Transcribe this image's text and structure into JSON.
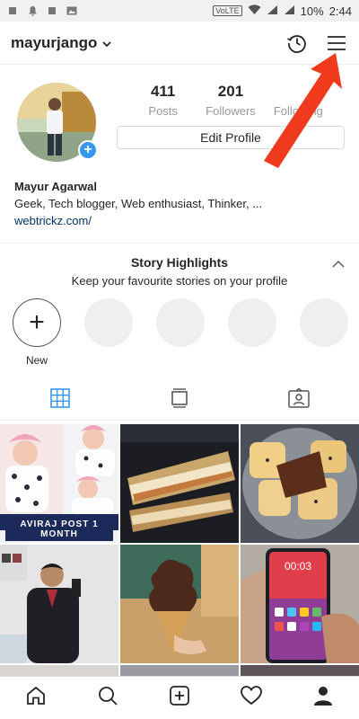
{
  "statusbar": {
    "network": "VoLTE",
    "battery": "10%",
    "time": "2:44"
  },
  "topbar": {
    "username": "mayurjango",
    "icons": [
      "chevron-down-icon",
      "archive-history-icon",
      "hamburger-menu-icon"
    ]
  },
  "profile": {
    "stats": [
      {
        "value": "411",
        "label": "Posts"
      },
      {
        "value": "201",
        "label": "Followers"
      },
      {
        "value": "",
        "label": "Following"
      }
    ],
    "edit_label": "Edit Profile"
  },
  "bio": {
    "name": "Mayur  Agarwal",
    "text": "Geek, Tech blogger, Web enthusiast, Thinker, ...",
    "link": "webtrickz.com/"
  },
  "highlights": {
    "title": "Story Highlights",
    "subtitle": "Keep your favourite stories on your profile",
    "new_label": "New"
  },
  "grid": {
    "overlay_text": "AVIRAJ POST 1 MONTH"
  },
  "phone_screen_time": "00:03",
  "colors": {
    "accent_blue": "#3897f0",
    "annotation_red": "#f03a1e",
    "tab_active": "#3897f0"
  }
}
